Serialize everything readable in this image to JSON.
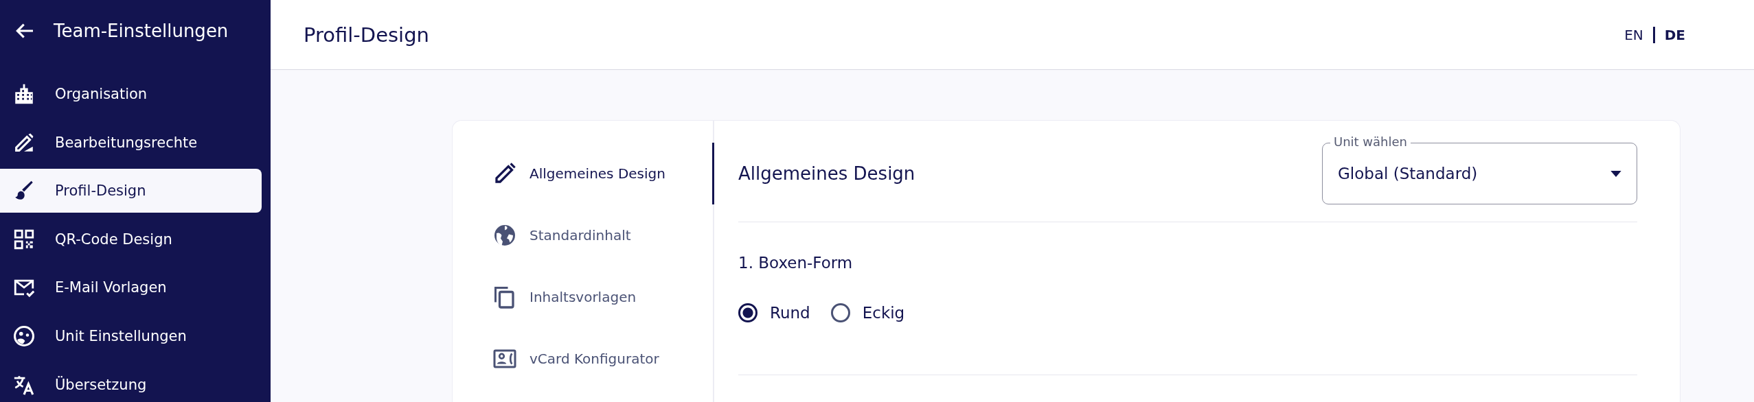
{
  "sidebar": {
    "title": "Team-Einstellungen",
    "items": [
      {
        "label": "Organisation",
        "selected": false
      },
      {
        "label": "Bearbeitungsrechte",
        "selected": false
      },
      {
        "label": "Profil-Design",
        "selected": true
      },
      {
        "label": "QR-Code Design",
        "selected": false
      },
      {
        "label": "E-Mail Vorlagen",
        "selected": false
      },
      {
        "label": "Unit Einstellungen",
        "selected": false
      },
      {
        "label": "Übersetzung",
        "selected": false
      }
    ]
  },
  "header": {
    "title": "Profil-Design",
    "languages": [
      {
        "label": "EN",
        "selected": false
      },
      {
        "label": "DE",
        "selected": true
      }
    ]
  },
  "design_nav": {
    "items": [
      {
        "label": "Allgemeines Design",
        "selected": true
      },
      {
        "label": "Standardinhalt",
        "selected": false
      },
      {
        "label": "Inhaltsvorlagen",
        "selected": false
      },
      {
        "label": "vCard Konfigurator",
        "selected": false
      }
    ]
  },
  "panel": {
    "title": "Allgemeines Design",
    "unit_select": {
      "label": "Unit wählen",
      "value": "Global (Standard)"
    },
    "section": {
      "title": "1. Boxen-Form",
      "options": [
        {
          "label": "Rund",
          "selected": true
        },
        {
          "label": "Eckig",
          "selected": false
        }
      ]
    }
  }
}
